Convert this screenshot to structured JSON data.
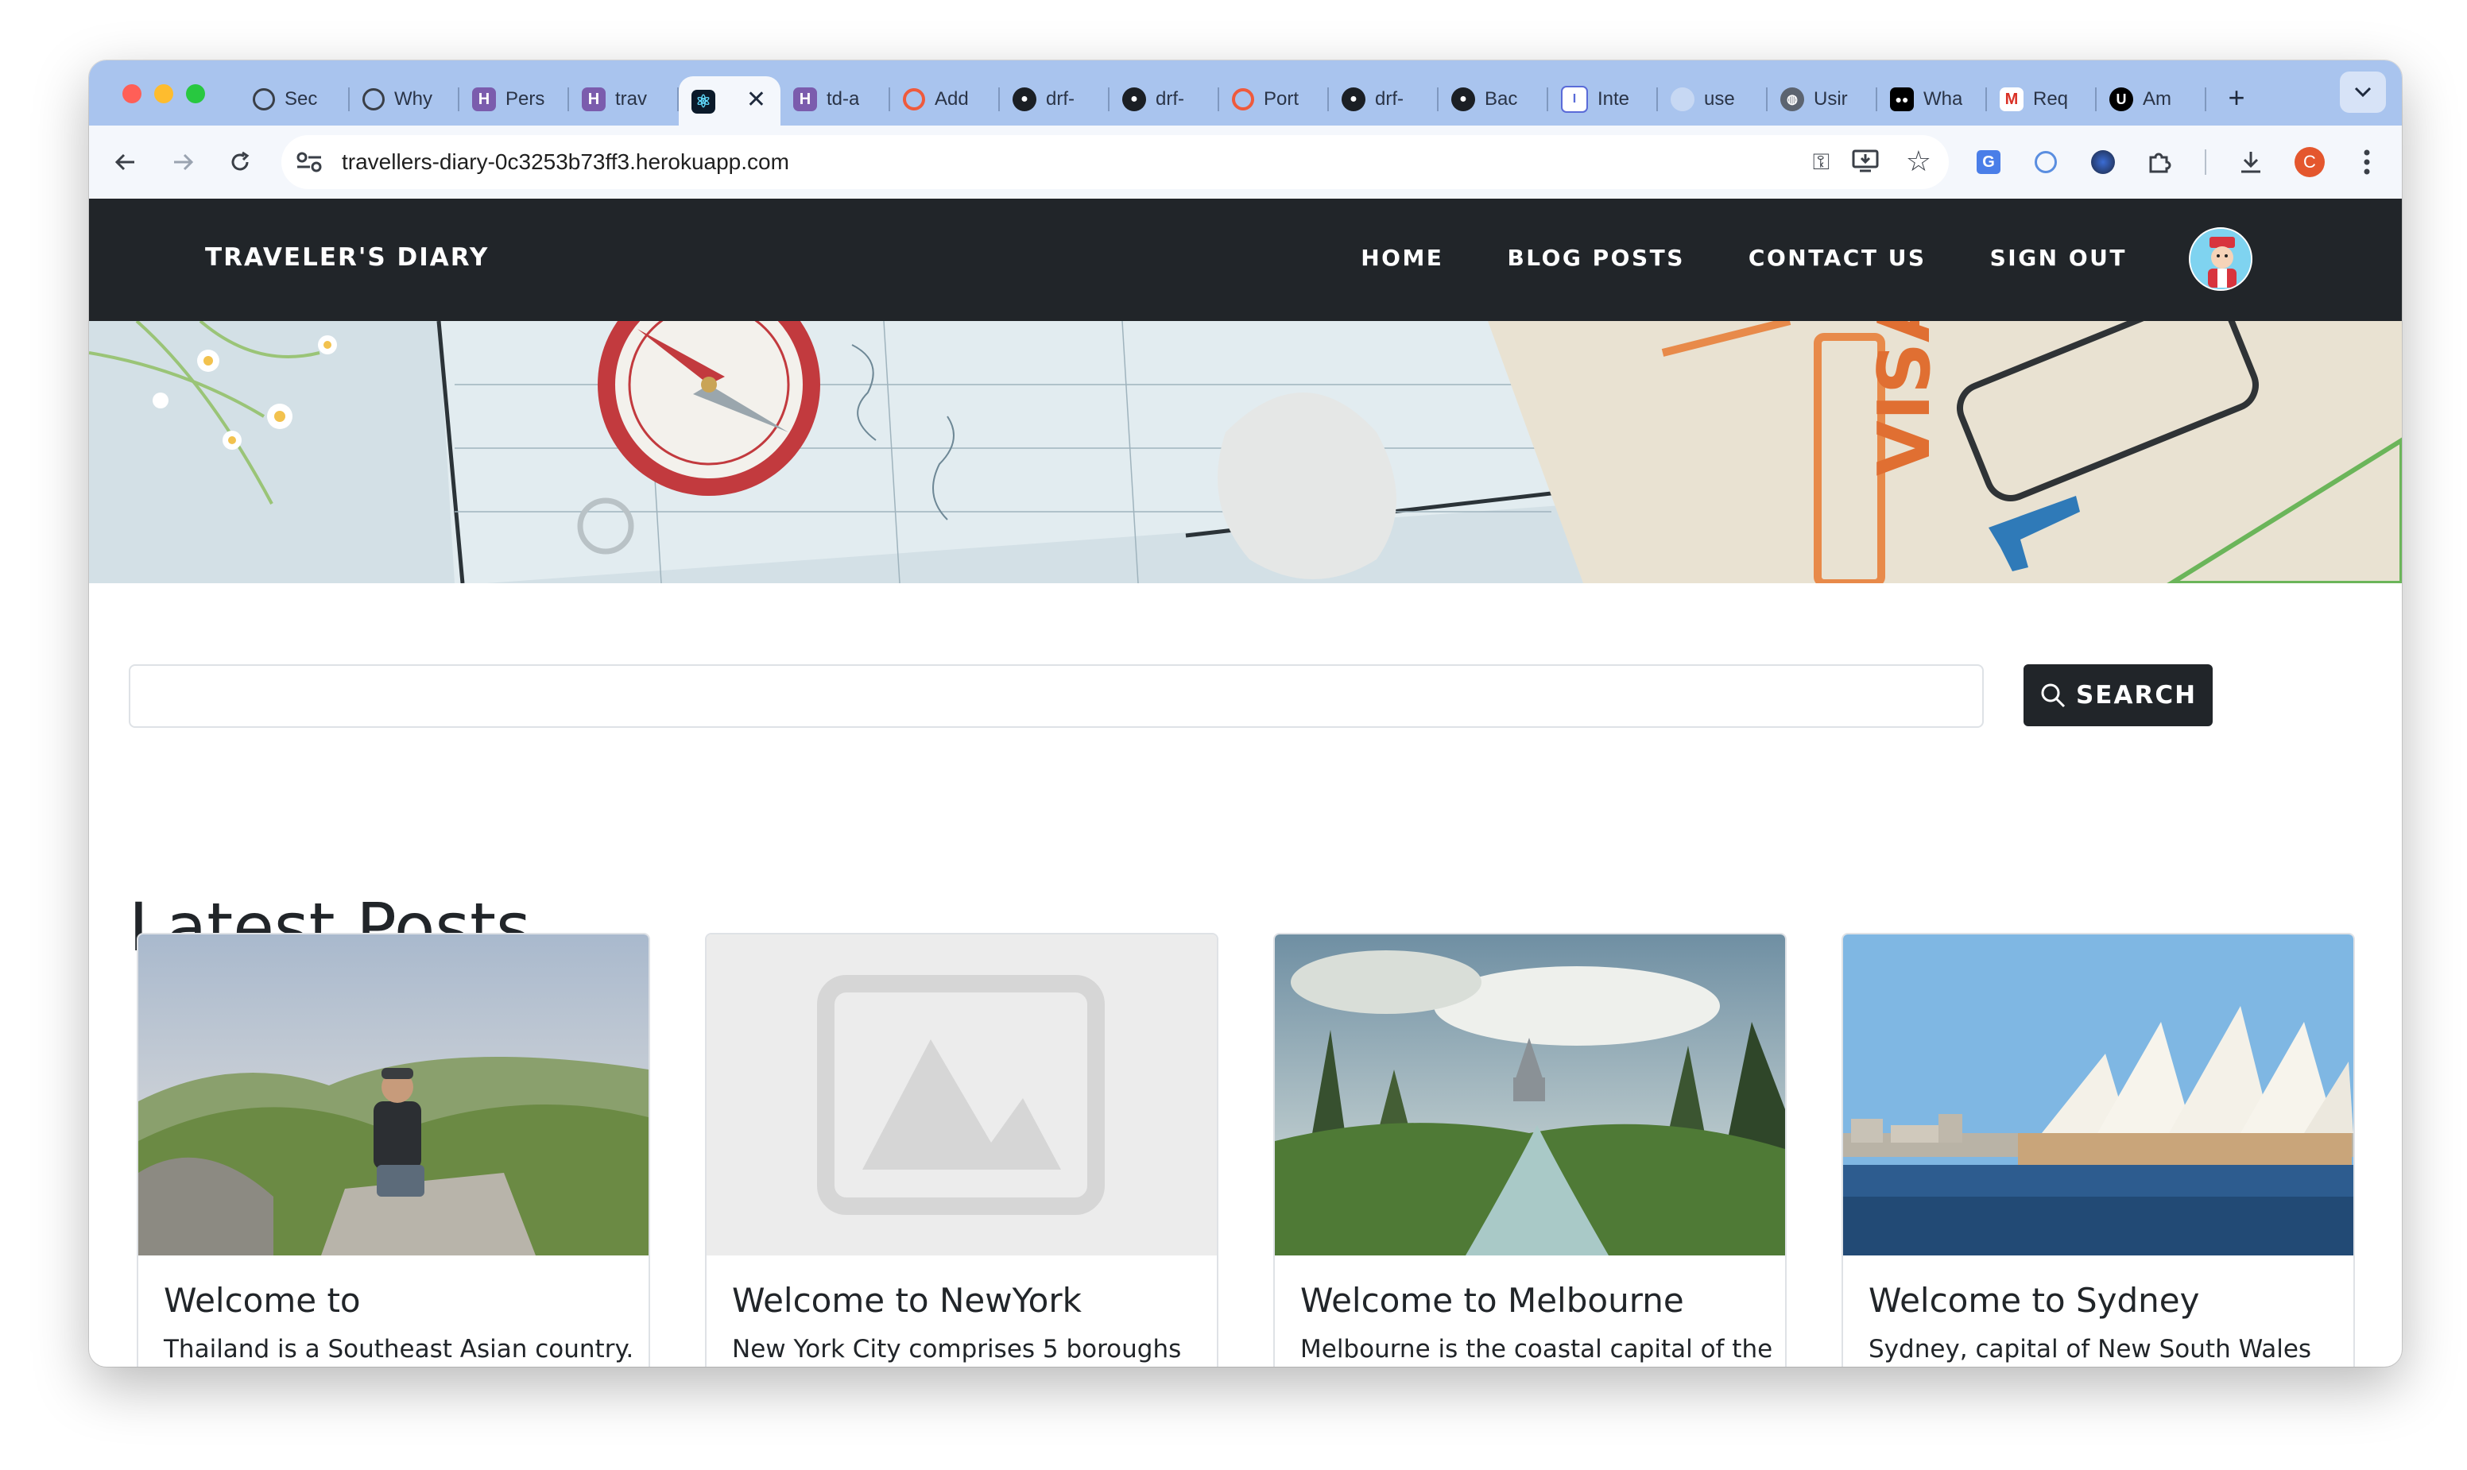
{
  "browser": {
    "tabs": [
      {
        "label": "Sec",
        "icon": "openai-icon"
      },
      {
        "label": "Why",
        "icon": "openai-icon"
      },
      {
        "label": "Pers",
        "icon": "heroku-icon"
      },
      {
        "label": "trav",
        "icon": "heroku-icon"
      },
      {
        "label": "",
        "icon": "react-icon",
        "active": true
      },
      {
        "label": "td-a",
        "icon": "heroku-icon"
      },
      {
        "label": "Add",
        "icon": "ring-icon"
      },
      {
        "label": "drf-",
        "icon": "github-icon"
      },
      {
        "label": "drf-",
        "icon": "github-icon"
      },
      {
        "label": "Port",
        "icon": "ring-icon"
      },
      {
        "label": "drf-",
        "icon": "github-icon"
      },
      {
        "label": "Bac",
        "icon": "github-icon"
      },
      {
        "label": "Inte",
        "icon": "tool-icon"
      },
      {
        "label": "use",
        "icon": "blank-icon"
      },
      {
        "label": "Usir",
        "icon": "globe-icon"
      },
      {
        "label": "Wha",
        "icon": "medium-icon"
      },
      {
        "label": "Req",
        "icon": "gmail-icon"
      },
      {
        "label": "Am",
        "icon": "udemy-icon"
      }
    ],
    "new_tab": "+",
    "address": "travellers-diary-0c3253b73ff3.herokuapp.com",
    "profile_initial": "C"
  },
  "site": {
    "brand": "TRAVELER'S DIARY",
    "nav": {
      "home": "HOME",
      "blog": "BLOG POSTS",
      "contact": "CONTACT US",
      "signout": "SIGN OUT"
    }
  },
  "search": {
    "placeholder": "",
    "button": "SEARCH"
  },
  "section_title": "Latest Posts",
  "posts": [
    {
      "title": "Welcome to",
      "excerpt": "Thailand is a Southeast Asian country."
    },
    {
      "title": "Welcome to NewYork",
      "excerpt": "New York City comprises 5 boroughs"
    },
    {
      "title": "Welcome to Melbourne",
      "excerpt": "Melbourne is the coastal capital of the"
    },
    {
      "title": "Welcome to Sydney",
      "excerpt": "Sydney, capital of New South Wales"
    }
  ],
  "colors": {
    "navbar": "#212529",
    "tabstrip": "#a9c4ee",
    "toolbar": "#f4f7fc"
  }
}
